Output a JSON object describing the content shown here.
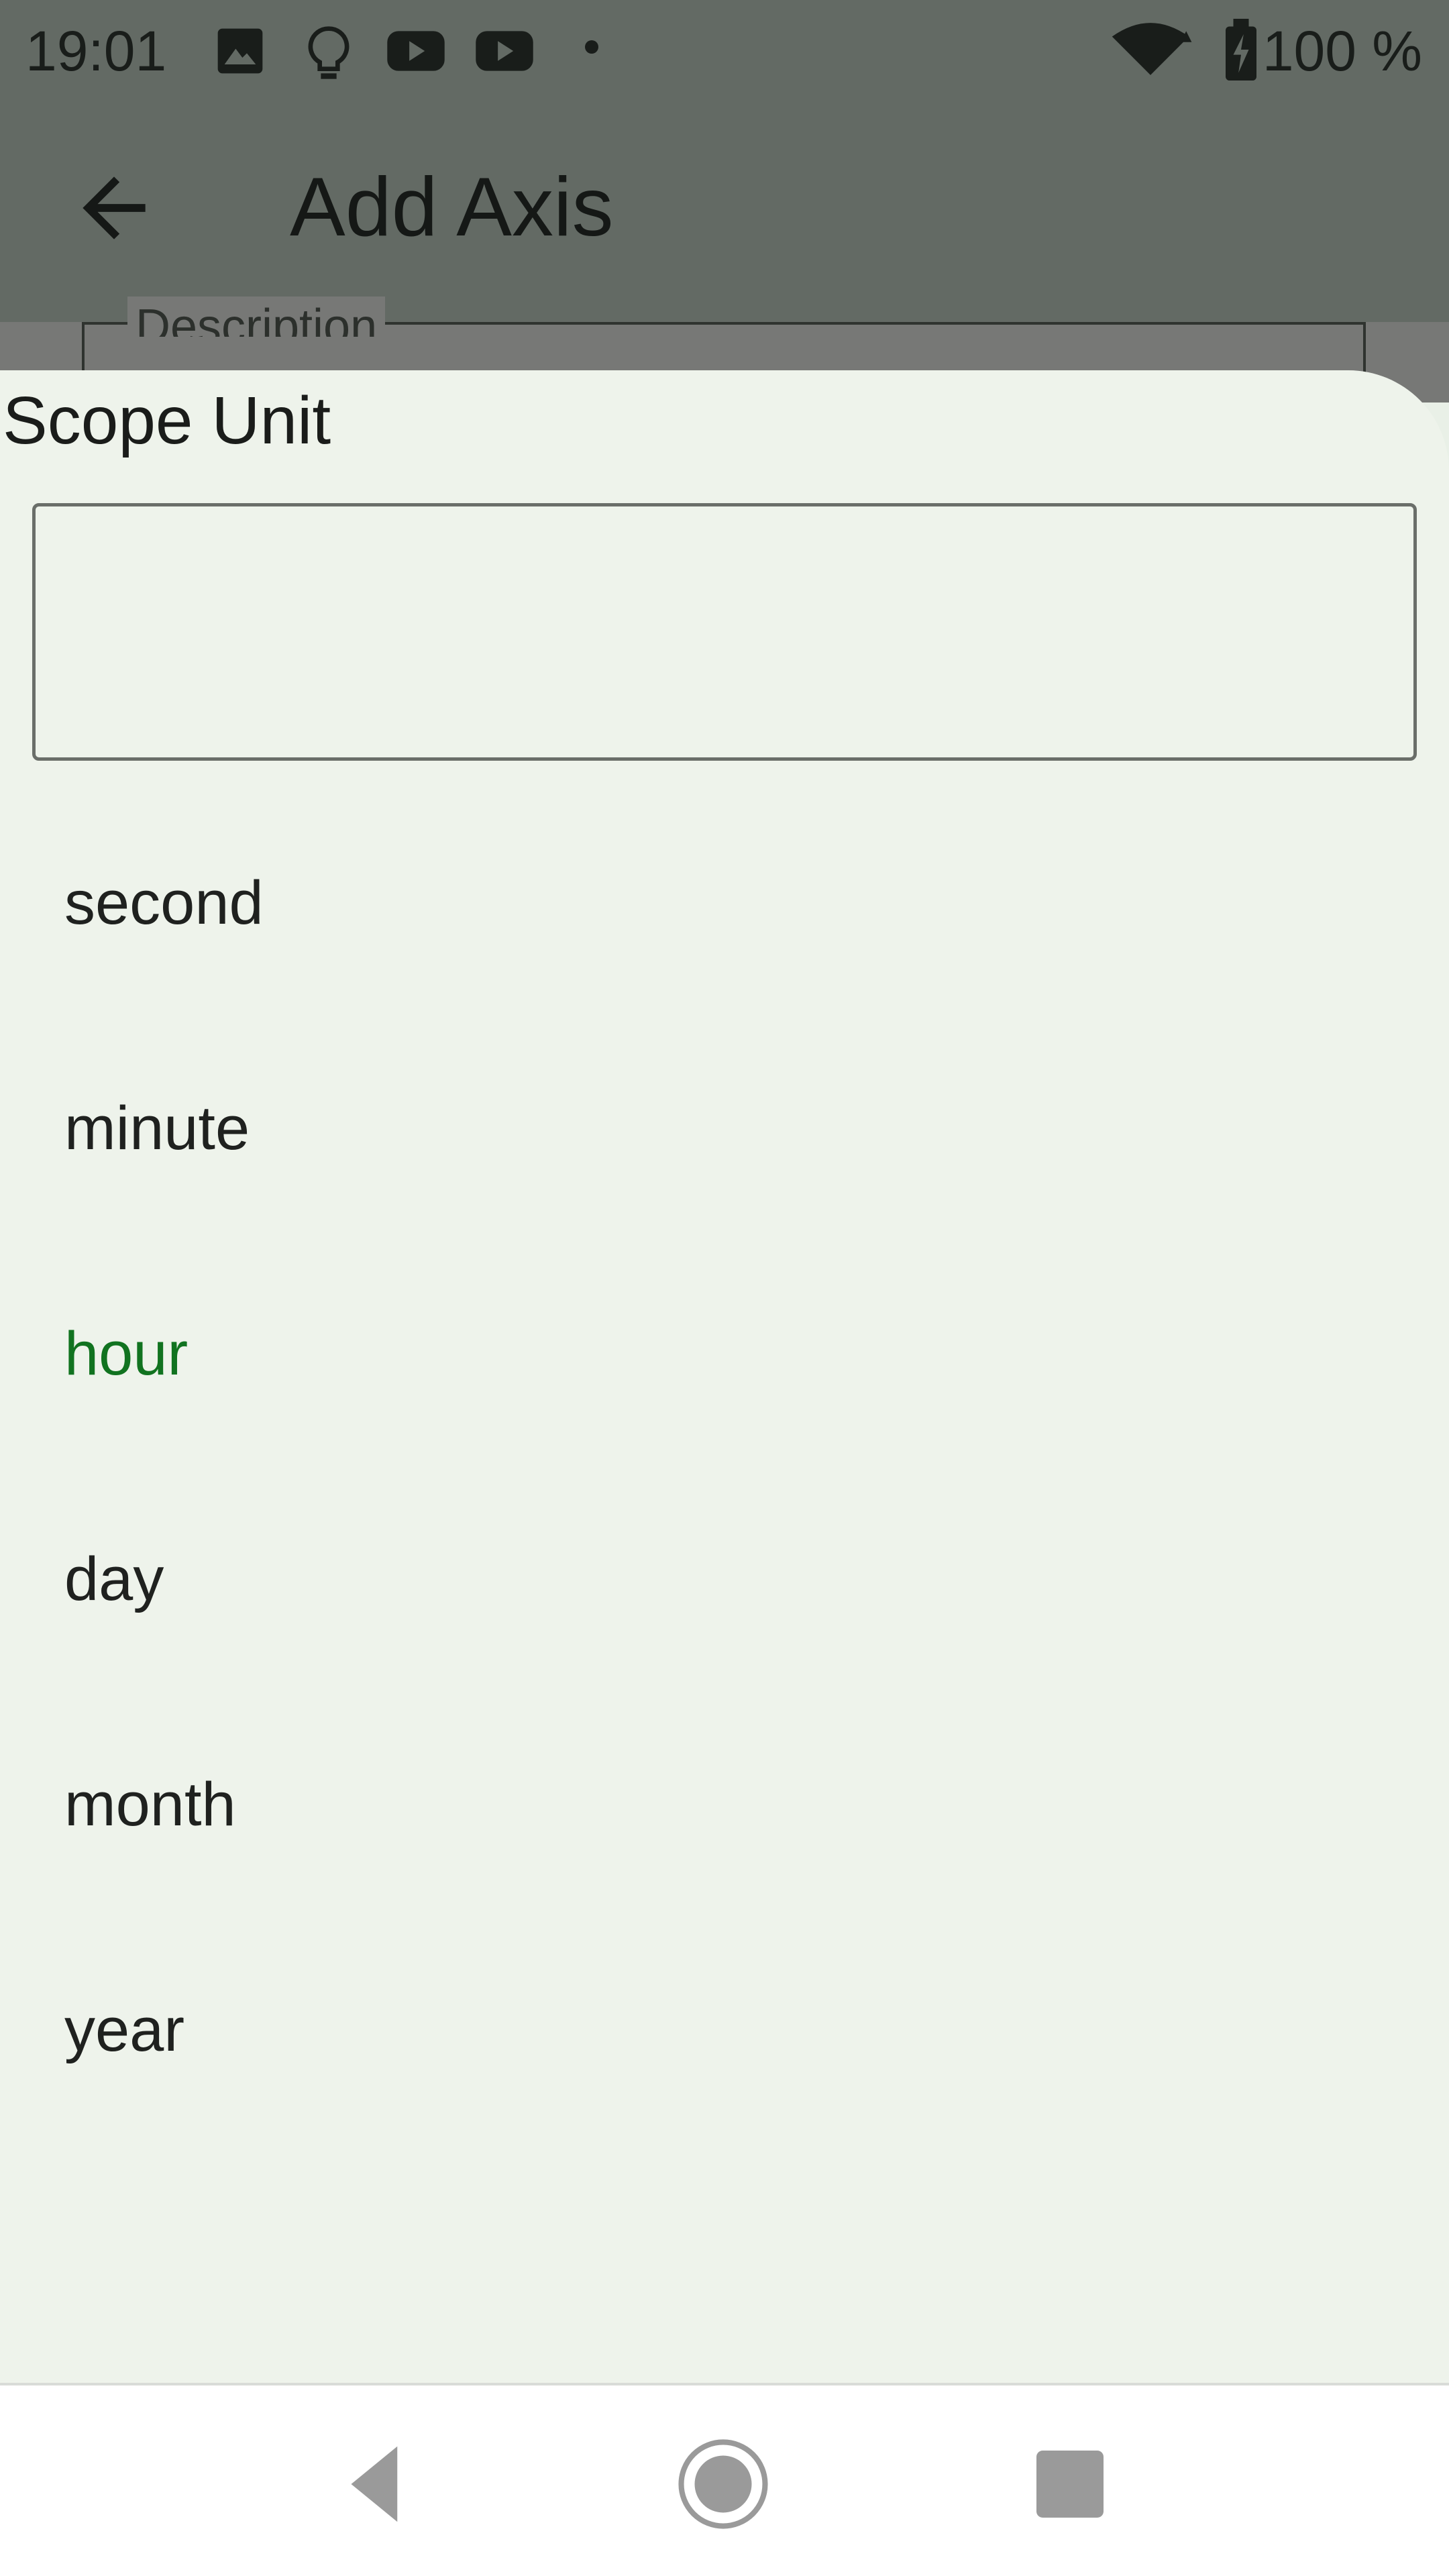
{
  "status_bar": {
    "time": "19:01",
    "battery": "100 %",
    "icons": [
      "image-icon",
      "lightbulb-icon",
      "youtube-icon",
      "youtube-icon",
      "dot-icon",
      "wifi-icon",
      "battery-charging-icon"
    ]
  },
  "app_bar": {
    "title": "Add Axis",
    "back_icon": "arrow-left-icon"
  },
  "underlying_form": {
    "description_label": "Description"
  },
  "sheet": {
    "title": "Scope Unit",
    "search_value": "",
    "options": [
      {
        "label": "second",
        "selected": false
      },
      {
        "label": "minute",
        "selected": false
      },
      {
        "label": "hour",
        "selected": true
      },
      {
        "label": "day",
        "selected": false
      },
      {
        "label": "month",
        "selected": false
      },
      {
        "label": "year",
        "selected": false
      }
    ],
    "selected_color": "#117320"
  },
  "nav_bar": {
    "icons": [
      "back-triangle-icon",
      "home-circle-icon",
      "recents-square-icon"
    ]
  }
}
